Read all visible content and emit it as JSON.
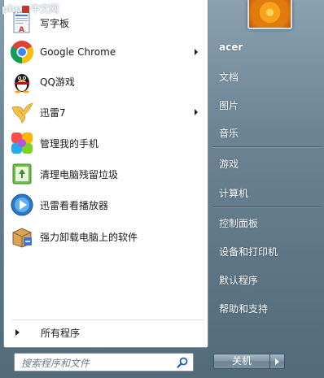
{
  "watermark": {
    "text": "中文网",
    "prefix": "php"
  },
  "pinned_apps": [
    {
      "label": "写字板",
      "icon": "wordpad-icon",
      "has_submenu": false
    },
    {
      "label": "Google Chrome",
      "icon": "chrome-icon",
      "has_submenu": true
    },
    {
      "label": "QQ游戏",
      "icon": "qq-penguin-icon",
      "has_submenu": false
    },
    {
      "label": "迅雷7",
      "icon": "thunder-bird-icon",
      "has_submenu": true
    },
    {
      "label": "管理我的手机",
      "icon": "colorful-flower-icon",
      "has_submenu": false
    },
    {
      "label": "清理电脑残留垃圾",
      "icon": "recycle-bin-icon",
      "has_submenu": false
    },
    {
      "label": "迅雷看看播放器",
      "icon": "play-circle-icon",
      "has_submenu": false
    },
    {
      "label": "强力卸载电脑上的软件",
      "icon": "uninstall-box-icon",
      "has_submenu": false
    }
  ],
  "all_programs_label": "所有程序",
  "search": {
    "placeholder": "搜索程序和文件"
  },
  "right_pane": {
    "user_name": "acer",
    "items": [
      "文档",
      "图片",
      "音乐",
      "游戏",
      "计算机",
      "控制面板",
      "设备和打印机",
      "默认程序",
      "帮助和支持"
    ]
  },
  "shutdown_label": "关机",
  "colors": {
    "accent": "#5d7585",
    "pane_bg": "#ffffff"
  }
}
